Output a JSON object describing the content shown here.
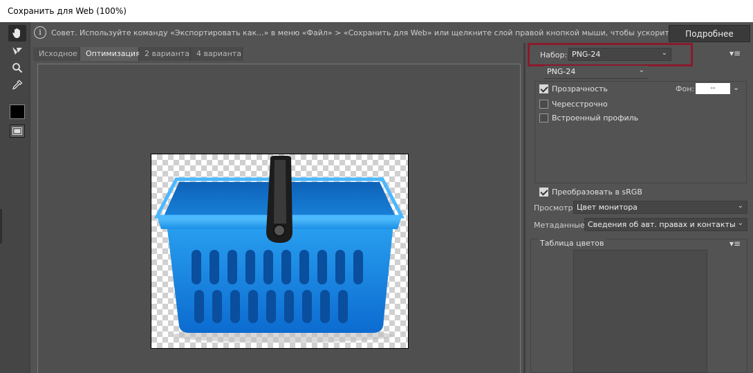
{
  "window": {
    "title": "Сохранить для Web (100%)"
  },
  "tip": {
    "icon": "info-icon",
    "icon_glyph": "i",
    "text": "Совет. Используйте команду «Экспортировать как...» в меню «Файл» > «Сохранить для Web» или щелкните слой правой кнопкой мыши, чтобы ускорить экспорт ресурсов",
    "more_button": "Подробнее"
  },
  "tools": [
    "hand-tool-icon",
    "slice-select-icon",
    "zoom-icon",
    "eyedropper-icon"
  ],
  "tabs": [
    {
      "label": "Исходное",
      "active": false
    },
    {
      "label": "Оптимизация",
      "active": true
    },
    {
      "label": "2 варианта",
      "active": false
    },
    {
      "label": "4 варианта",
      "active": false
    }
  ],
  "settings": {
    "preset_label": "Набор:",
    "preset_value": "PNG-24",
    "format_value": "PNG-24",
    "transparency_label": "Прозрачность",
    "transparency_checked": true,
    "matte_label": "Фон:",
    "matte_value": "--",
    "interlaced_label": "Чересстрочно",
    "interlaced_checked": false,
    "embed_profile_label": "Встроенный профиль",
    "embed_profile_checked": false,
    "convert_srgb_label": "Преобразовать в sRGB",
    "convert_srgb_checked": true,
    "preview_label": "Просмотр:",
    "preview_value": "Цвет монитора",
    "metadata_label": "Метаданные:",
    "metadata_value": "Сведения об авт. правах и контакты",
    "color_table_label": "Таблица цветов"
  },
  "colors": {
    "highlight": "#8b1a2b",
    "basket_blue": "#1e88e5",
    "handle": "#1a1a1a"
  }
}
